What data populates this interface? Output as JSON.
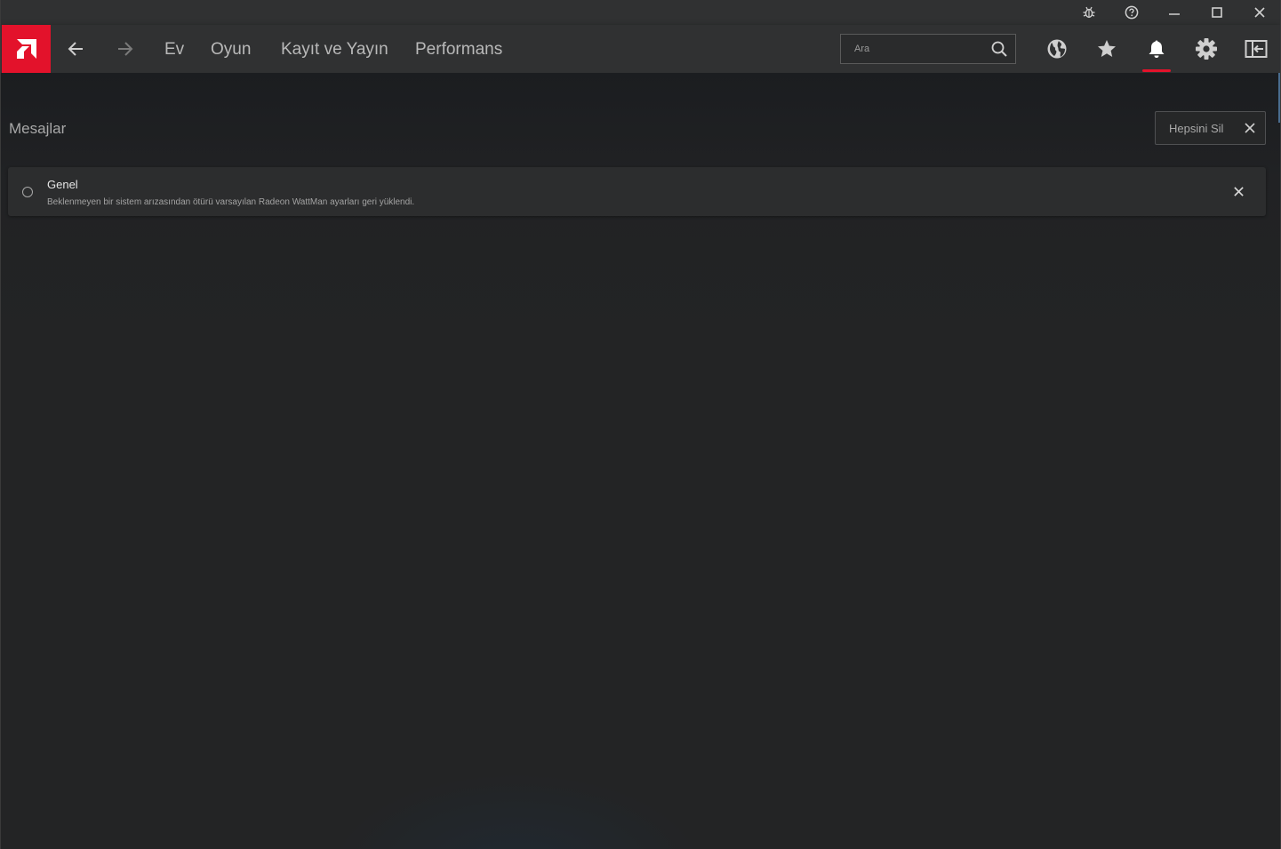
{
  "titlebar": {
    "icons": [
      "bug-icon",
      "help-icon",
      "minimize-icon",
      "maximize-icon",
      "close-icon"
    ]
  },
  "nav": {
    "back_icon": "arrow-left-icon",
    "forward_icon": "arrow-right-icon",
    "links": [
      "Ev",
      "Oyun",
      "Kayıt ve Yayın",
      "Performans"
    ],
    "search_placeholder": "Ara",
    "right_icons": [
      "globe-icon",
      "star-icon",
      "bell-icon",
      "gear-icon",
      "sidebar-layout-icon"
    ],
    "active_icon": "bell-icon"
  },
  "colors": {
    "accent": "#e3122b",
    "background": "#232425",
    "bar": "#303132"
  },
  "page": {
    "title": "Mesajlar",
    "clear_all_label": "Hepsini Sil"
  },
  "notifications": [
    {
      "title": "Genel",
      "message": "Beklenmeyen bir sistem arızasından ötürü varsayılan Radeon WattMan ayarları geri yüklendi."
    }
  ]
}
